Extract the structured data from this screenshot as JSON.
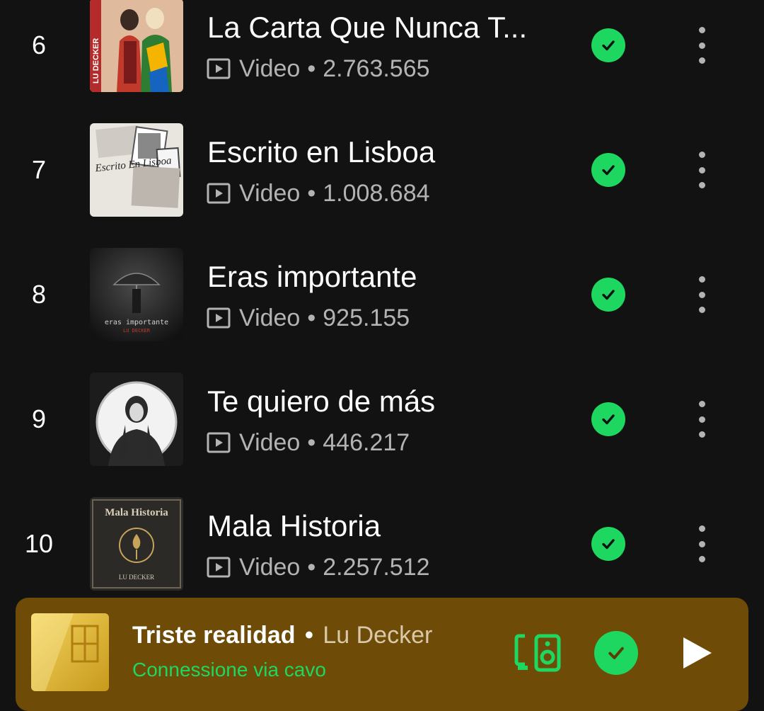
{
  "colors": {
    "background": "#121212",
    "accent_green": "#1ed760",
    "secondary_text": "#b3b3b3",
    "mini_player_bg": "#6e4b07"
  },
  "tracks": [
    {
      "rank": "6",
      "title": "La Carta Que Nunca T...",
      "type": "Video",
      "plays": "2.763.565",
      "downloaded": true
    },
    {
      "rank": "7",
      "title": "Escrito en Lisboa",
      "type": "Video",
      "plays": "1.008.684",
      "downloaded": true
    },
    {
      "rank": "8",
      "title": "Eras importante",
      "type": "Video",
      "plays": "925.155",
      "downloaded": true
    },
    {
      "rank": "9",
      "title": "Te quiero de más",
      "type": "Video",
      "plays": "446.217",
      "downloaded": true
    },
    {
      "rank": "10",
      "title": "Mala Historia",
      "type": "Video",
      "plays": "2.257.512",
      "downloaded": true
    }
  ],
  "covers": {
    "cover1_brand": "LU DECKER",
    "cover2_text": "Escrito En Lisboa",
    "cover3_text": "eras importante",
    "cover3_artist": "LU DECKER",
    "cover5_title": "Mala Historia",
    "cover5_artist": "LU DECKER"
  },
  "meta": {
    "separator": "•"
  },
  "now_playing": {
    "title": "Triste realidad",
    "separator": "•",
    "artist": "Lu Decker",
    "device": "Connessione via cavo",
    "icons": [
      "devices-icon",
      "check-icon",
      "play-icon"
    ]
  }
}
